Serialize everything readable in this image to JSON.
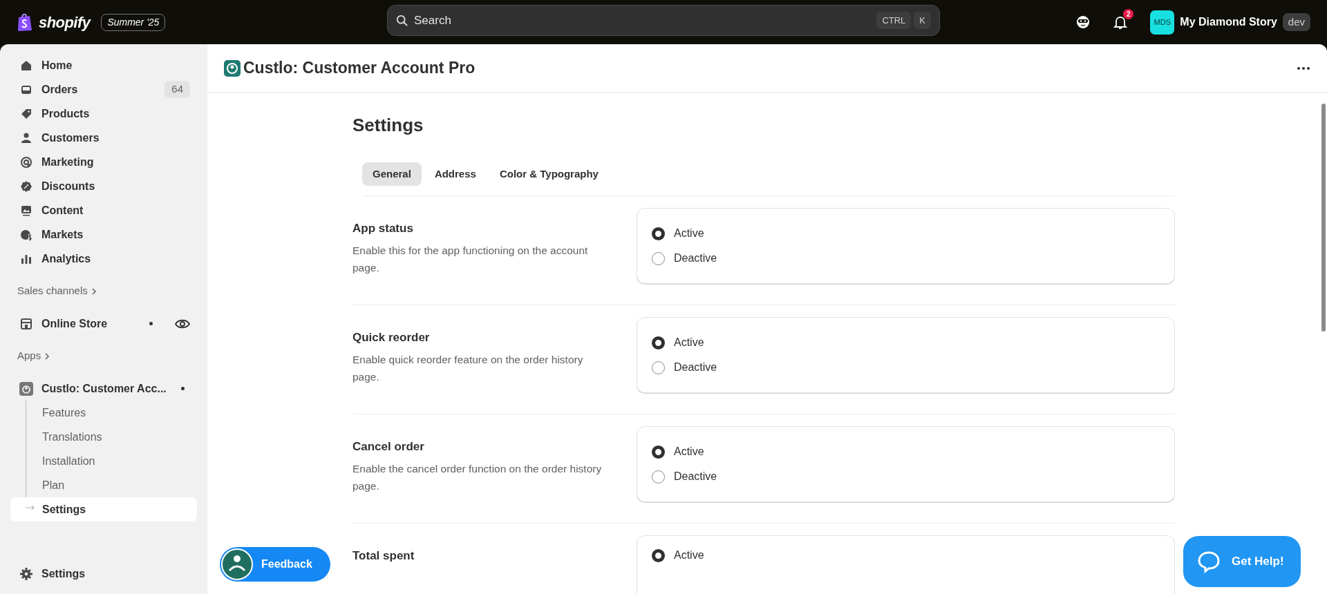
{
  "topbar": {
    "brand": "shopify",
    "edition": "Summer '25",
    "search": {
      "placeholder": "Search"
    },
    "shortcut": [
      "CTRL",
      "K"
    ],
    "notification_count": "2",
    "store": {
      "initials": "MDS",
      "name": "My Diamond Story",
      "badge": "dev"
    }
  },
  "sidebar": {
    "items": [
      {
        "label": "Home",
        "selected": false
      },
      {
        "label": "Orders",
        "badge": "64",
        "selected": false
      },
      {
        "label": "Products",
        "selected": false
      },
      {
        "label": "Customers",
        "selected": false
      },
      {
        "label": "Marketing",
        "selected": false
      },
      {
        "label": "Discounts",
        "selected": false
      },
      {
        "label": "Content",
        "selected": false
      },
      {
        "label": "Markets",
        "selected": false
      },
      {
        "label": "Analytics",
        "selected": false
      }
    ],
    "sales_channels": {
      "heading": "Sales channels",
      "items": [
        {
          "label": "Online Store",
          "selected": false
        }
      ]
    },
    "apps": {
      "heading": "Apps",
      "items": [
        {
          "label": "Custlo: Customer Acc...",
          "selected": false,
          "children": [
            {
              "label": "Features",
              "selected": false
            },
            {
              "label": "Translations",
              "selected": false
            },
            {
              "label": "Installation",
              "selected": false
            },
            {
              "label": "Plan",
              "selected": false
            },
            {
              "label": "Settings",
              "selected": true
            }
          ]
        }
      ]
    },
    "footer_item": {
      "label": "Settings"
    }
  },
  "page": {
    "app_title": "Custlo: Customer Account Pro",
    "title": "Settings",
    "tabs": [
      {
        "label": "General",
        "selected": true
      },
      {
        "label": "Address",
        "selected": false
      },
      {
        "label": "Color & Typography",
        "selected": false
      }
    ],
    "sections": [
      {
        "title": "App status",
        "description": "Enable this for the app functioning on the account page.",
        "options": [
          {
            "label": "Active",
            "selected": true
          },
          {
            "label": "Deactive",
            "selected": false
          }
        ]
      },
      {
        "title": "Quick reorder",
        "description": "Enable quick reorder feature on the order history page.",
        "options": [
          {
            "label": "Active",
            "selected": true
          },
          {
            "label": "Deactive",
            "selected": false
          }
        ]
      },
      {
        "title": "Cancel order",
        "description": "Enable the cancel order function on the order history page.",
        "options": [
          {
            "label": "Active",
            "selected": true
          },
          {
            "label": "Deactive",
            "selected": false
          }
        ]
      },
      {
        "title": "Total spent",
        "options": [
          {
            "label": "Active",
            "selected": true
          }
        ]
      }
    ]
  },
  "feedback_button": "Feedback",
  "help_button": "Get Help!"
}
